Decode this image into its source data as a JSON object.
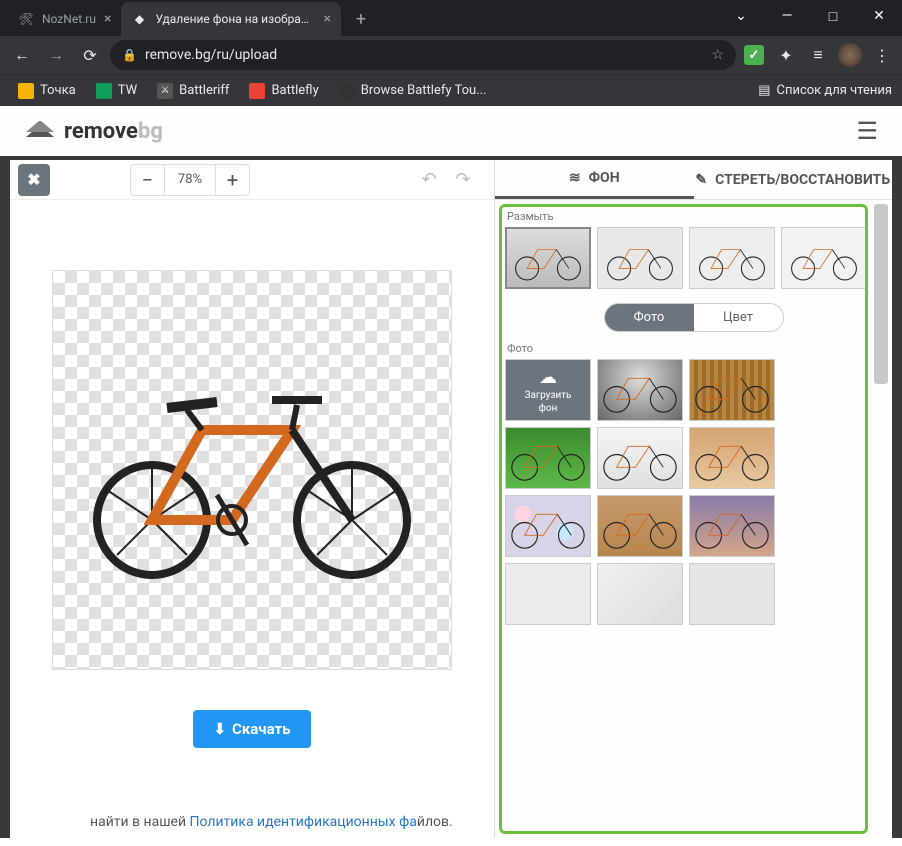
{
  "window_controls": {
    "min": "—",
    "max": "□",
    "close": "✕",
    "chevron": "⌄"
  },
  "tabs": [
    {
      "title": "NozNet.ru",
      "active": false
    },
    {
      "title": "Удаление фона на изображени",
      "active": true
    }
  ],
  "nav": {
    "back": "←",
    "forward": "→",
    "reload": "⟳"
  },
  "address": {
    "lock": "🔒",
    "url": "remove.bg/ru/upload",
    "star": "☆"
  },
  "extensions": {
    "menu": "⋮",
    "puzzle": "✦",
    "list": "≡"
  },
  "bookmarks": [
    {
      "label": "Точка",
      "color": "#f4b400"
    },
    {
      "label": "TW",
      "color": "#0f9d58"
    },
    {
      "label": "Battleriff",
      "color": "#555"
    },
    {
      "label": "Battlefly",
      "color": "#ea4335"
    },
    {
      "label": "Browse Battlefy Tou...",
      "color": "#4285f4"
    }
  ],
  "reading_list": {
    "icon": "▤",
    "label": "Список для чтения"
  },
  "site": {
    "logo_bold": "remove",
    "logo_light": "bg",
    "hamburger": "☰"
  },
  "editor": {
    "close": "✖",
    "zoom_out": "−",
    "zoom_val": "78%",
    "zoom_in": "+",
    "undo": "↶",
    "redo": "↷",
    "download_icon": "⬇",
    "download_label": "Скачать"
  },
  "side": {
    "tab_bg_icon": "≋",
    "tab_bg": "ФОН",
    "tab_erase_icon": "✎",
    "tab_erase": "СТЕРЕТЬ/ВОССТАНОВИТЬ",
    "blur_label": "Размыть",
    "toggle_photo": "Фото",
    "toggle_color": "Цвет",
    "photo_label": "Фото",
    "upload_icon": "☁",
    "upload_line1": "Загрузить",
    "upload_line2": "фон"
  },
  "footer": {
    "text_before": "найти в нашей ",
    "link": "Политика идентификационных фа",
    "text_after": "йлов."
  }
}
